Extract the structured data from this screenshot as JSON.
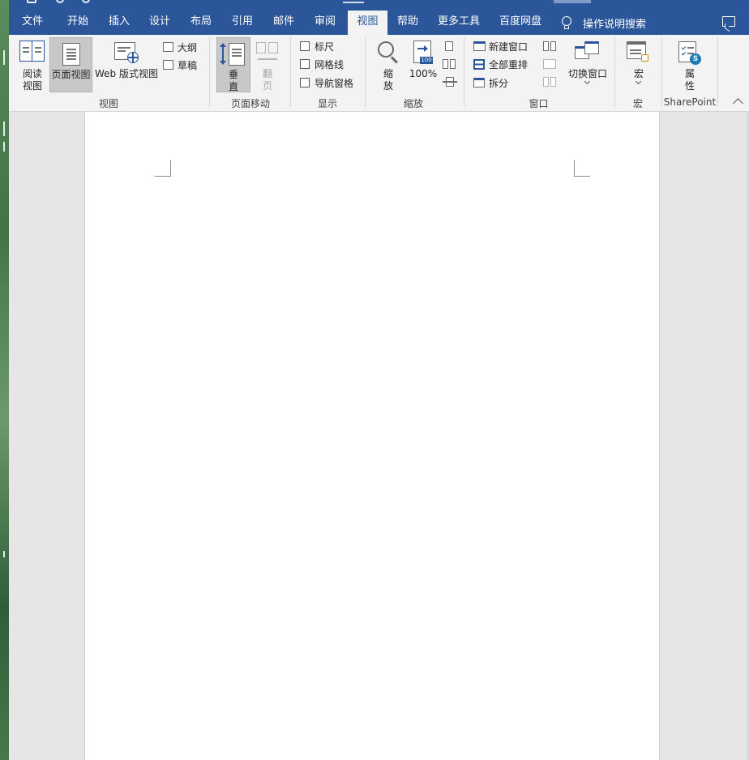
{
  "tabs": [
    {
      "label": "文件",
      "active": false
    },
    {
      "label": "开始",
      "active": false
    },
    {
      "label": "插入",
      "active": false
    },
    {
      "label": "设计",
      "active": false
    },
    {
      "label": "布局",
      "active": false
    },
    {
      "label": "引用",
      "active": false
    },
    {
      "label": "邮件",
      "active": false
    },
    {
      "label": "审阅",
      "active": false
    },
    {
      "label": "视图",
      "active": true
    },
    {
      "label": "帮助",
      "active": false
    },
    {
      "label": "更多工具",
      "active": false
    },
    {
      "label": "百度网盘",
      "active": false
    }
  ],
  "search_label": "操作说明搜索",
  "ribbon": {
    "views": {
      "label": "视图",
      "read_line1": "阅读",
      "read_line2": "视图",
      "print_layout": "页面视图",
      "web_layout": "Web 版式视图",
      "outline": "大纲",
      "draft": "草稿"
    },
    "page_movement": {
      "label": "页面移动",
      "vertical_line1": "垂",
      "vertical_line2": "直",
      "side_line1": "翻",
      "side_line2": "页"
    },
    "show": {
      "label": "显示",
      "ruler": "标尺",
      "gridlines": "网格线",
      "nav_pane": "导航窗格"
    },
    "zoom": {
      "label": "缩放",
      "zoom_line1": "缩",
      "zoom_line2": "放",
      "hundred": "100%",
      "hundred_badge": "100"
    },
    "window": {
      "label": "窗口",
      "new_window": "新建窗口",
      "arrange_all": "全部重排",
      "split": "拆分",
      "switch_windows": "切换窗口"
    },
    "macros": {
      "label": "宏",
      "macros_button": "宏"
    },
    "sharepoint": {
      "label": "SharePoint",
      "properties_line1": "属",
      "properties_line2": "性"
    }
  },
  "colors": {
    "accent": "#2b579a",
    "ribbon_bg": "#f3f3f3",
    "workspace": "#e6e6e6"
  }
}
